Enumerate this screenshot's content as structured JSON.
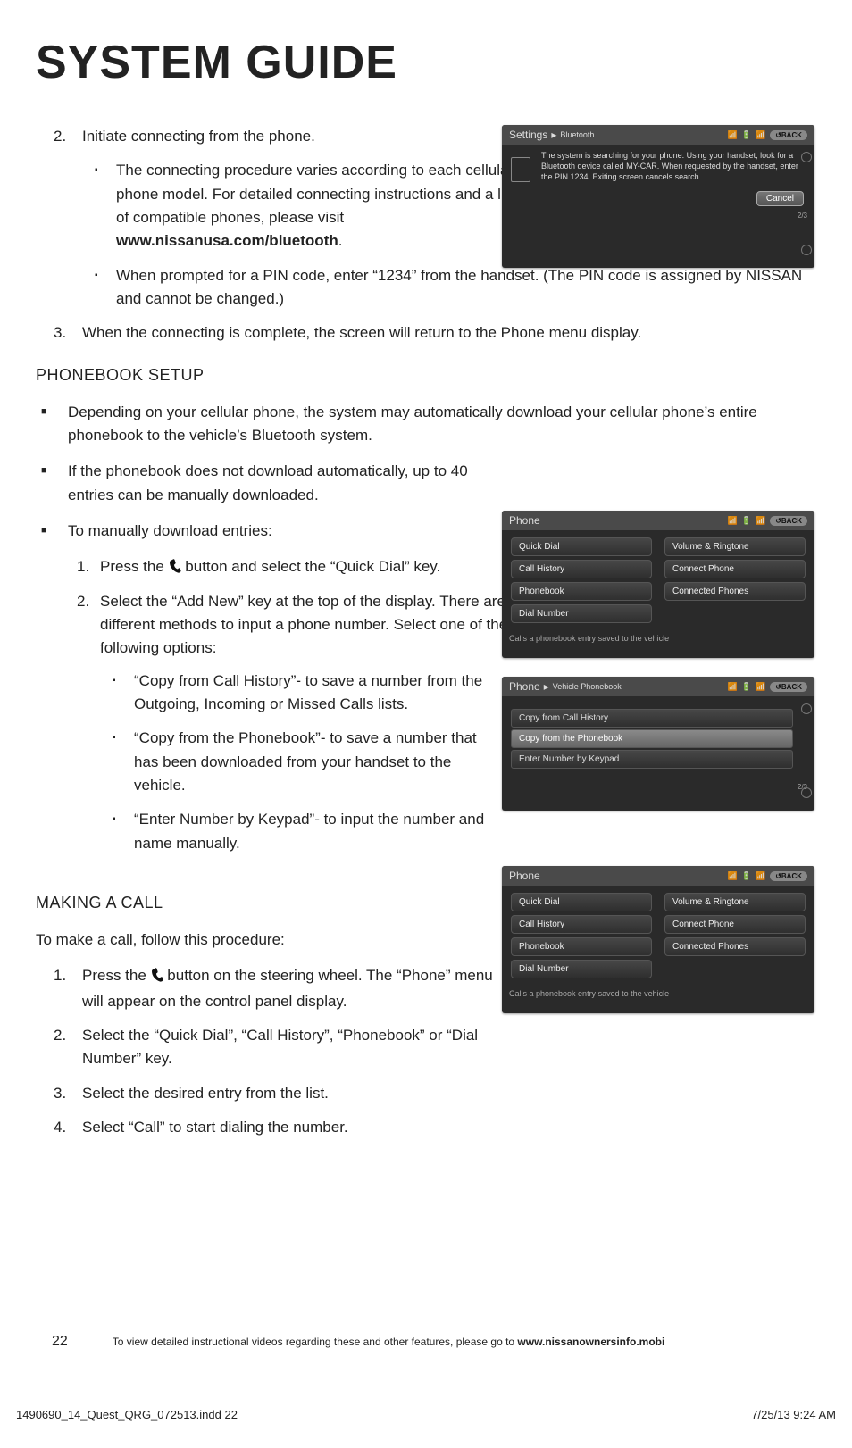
{
  "title": "SYSTEM GUIDE",
  "steps": {
    "s2_num": "2.",
    "s2": "Initiate connecting from the phone.",
    "s2a_pre": "The connecting procedure varies according to each cellular phone model. For detailed connecting instructions and a list of compatible phones, please visit ",
    "s2a_bold": "www.nissanusa.com/bluetooth",
    "s2a_post": ".",
    "s2b": "When prompted for a PIN code, enter “1234” from the handset. (The PIN code is assigned by NISSAN and cannot be changed.)",
    "s3_num": "3.",
    "s3": "When the connecting is complete, the screen will return to the Phone menu display."
  },
  "phonebook": {
    "heading": "PHONEBOOK SETUP",
    "b1": "Depending on your cellular phone, the system may automatically download your cellular phone’s entire phonebook to the vehicle’s Bluetooth system.",
    "b2": "If the phonebook does not download automatically, up to 40 entries can be manually downloaded.",
    "b3": "To manually download entries:",
    "o1_num": "1.",
    "o1a": "Press the ",
    "o1b": " button and select the “Quick Dial” key.",
    "o2_num": "2.",
    "o2": "Select the “Add New” key at the top of the display. There are different methods to input a phone number. Select one of the following options:",
    "o2a": "“Copy from Call History”- to save a number from the Outgoing, Incoming or Missed Calls lists.",
    "o2b": "“Copy from the Phonebook”- to save a number that has been downloaded from your handset to the vehicle.",
    "o2c": "“Enter Number by Keypad”- to input the number and name manually."
  },
  "makecall": {
    "heading": "MAKING A CALL",
    "intro": "To make a call, follow this procedure:",
    "s1_num": "1.",
    "s1a": "Press the ",
    "s1b": " button on the steering wheel. The “Phone” menu will appear on the control panel display.",
    "s2_num": "2.",
    "s2": "Select the “Quick Dial”, “Call History”, “Phonebook” or “Dial Number” key.",
    "s3_num": "3.",
    "s3": "Select the desired entry from the list.",
    "s4_num": "4.",
    "s4": "Select “Call” to start dialing the number."
  },
  "shot1": {
    "title": "Settings",
    "crumb": "Bluetooth",
    "back": "↺BACK",
    "msg": "The system is searching for your phone. Using your handset, look for a Bluetooth device called MY-CAR. When requested by the handset, enter the PIN 1234. Exiting screen cancels search.",
    "cancel": "Cancel",
    "pager": "2/3"
  },
  "shot_phone": {
    "title": "Phone",
    "back": "↺BACK",
    "items": [
      "Quick Dial",
      "Call History",
      "Phonebook",
      "Dial Number",
      "Volume & Ringtone",
      "Connect Phone",
      "Connected Phones"
    ],
    "foot": "Calls a phonebook entry saved to the vehicle"
  },
  "shot_list": {
    "title": "Phone",
    "crumb": "Vehicle Phonebook",
    "back": "↺BACK",
    "rows": [
      "Copy from Call History",
      "Copy from the Phonebook",
      "Enter Number by Keypad"
    ],
    "pager": "2/3"
  },
  "footer": {
    "page": "22",
    "text_a": "To view detailed instructional videos regarding these and other features, please go to ",
    "text_b": "www.nissanownersinfo.mobi"
  },
  "indd": {
    "left": "1490690_14_Quest_QRG_072513.indd   22",
    "right": "7/25/13   9:24 AM"
  }
}
